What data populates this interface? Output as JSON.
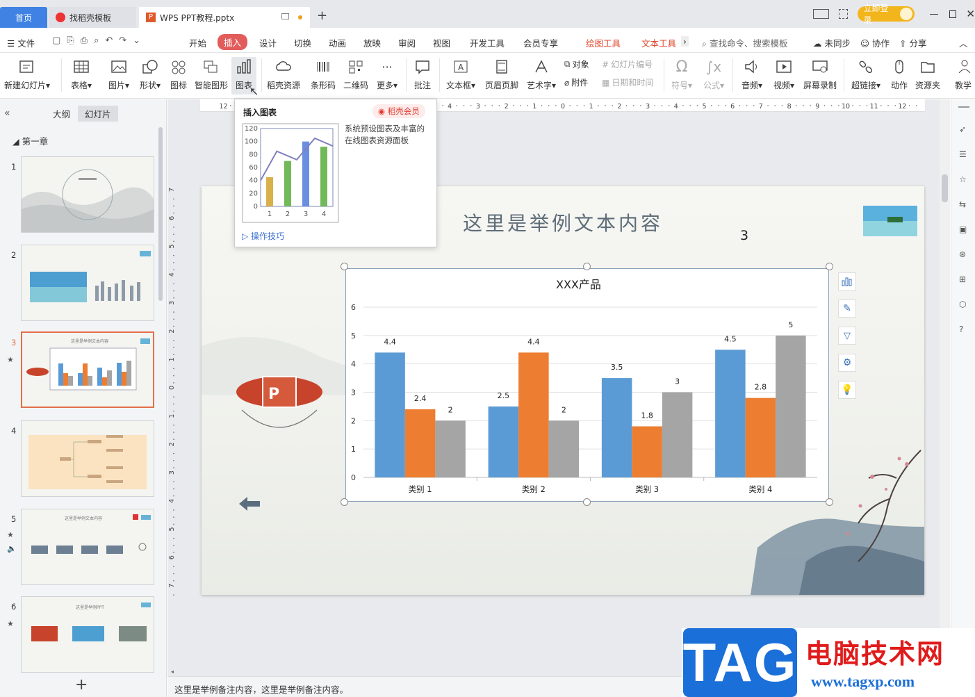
{
  "titlebar": {
    "home": "首页",
    "tab_template": "找稻壳模板",
    "tab_doc": "WPS PPT教程.pptx",
    "new_tab": "+",
    "login": "立即登录",
    "window_buttons": [
      "minimize",
      "maximize",
      "close"
    ]
  },
  "menu": {
    "file": "文件",
    "items": [
      "开始",
      "插入",
      "设计",
      "切换",
      "动画",
      "放映",
      "审阅",
      "视图",
      "开发工具",
      "会员专享"
    ],
    "active": "插入",
    "contextual": [
      "绘图工具",
      "文本工具"
    ],
    "search": "查找命令、搜索模板",
    "sync": "未同步",
    "collab": "协作",
    "share": "分享"
  },
  "ribbon": {
    "buttons": [
      "新建幻灯片",
      "表格",
      "图片",
      "形状",
      "图标",
      "智能图形",
      "图表",
      "稻壳资源",
      "条形码",
      "二维码",
      "更多",
      "批注",
      "文本框",
      "页眉页脚",
      "艺术字",
      "符号",
      "公式",
      "音频",
      "视频",
      "屏幕录制",
      "超链接",
      "动作",
      "资源夹",
      "教学"
    ],
    "small": [
      "对象",
      "附件",
      "幻灯片编号",
      "日期和时间"
    ]
  },
  "tooltip": {
    "title": "插入图表",
    "badge": "稻壳会员",
    "desc": "系统预设图表及丰富的在线图表资源面板",
    "help": "操作技巧",
    "preview": {
      "y_ticks": [
        "120",
        "100",
        "80",
        "60",
        "40",
        "20",
        "0"
      ],
      "x_ticks": [
        "1",
        "2",
        "3",
        "4"
      ]
    }
  },
  "leftpanel": {
    "tab_outline": "大纲",
    "tab_slides": "幻灯片",
    "section": "第一章",
    "add": "+",
    "slides": [
      "1",
      "2",
      "3",
      "4",
      "5",
      "6"
    ]
  },
  "slide": {
    "title": "这里是举例文本内容",
    "number": "3",
    "chart_title": "XXX产品"
  },
  "notes": "这里是举例备注内容，这里是举例备注内容。",
  "watermark": {
    "tag": "TAG",
    "site": "电脑技术网",
    "url": "www.tagxp.com"
  },
  "chart_data": [
    {
      "type": "bar",
      "title": "XXX产品",
      "categories": [
        "类别 1",
        "类别 2",
        "类别 3",
        "类别 4"
      ],
      "series": [
        {
          "values": [
            4.4,
            2.5,
            3.5,
            4.5
          ],
          "color": "#5b9bd5"
        },
        {
          "values": [
            2.4,
            4.4,
            1.8,
            2.8
          ],
          "color": "#ed7d31"
        },
        {
          "values": [
            2,
            2,
            3,
            5
          ],
          "color": "#a5a5a5"
        }
      ],
      "ylim": [
        0,
        6
      ],
      "y_ticks": [
        "0",
        "1",
        "2",
        "3",
        "4",
        "5",
        "6"
      ],
      "grid": true
    },
    {
      "type": "bar",
      "title": "",
      "categories": [
        "1",
        "2",
        "3",
        "4"
      ],
      "values": [
        45,
        70,
        100,
        92
      ],
      "colors": [
        "#d8b14b",
        "#72b95a",
        "#6a8ee0",
        "#72b95a"
      ],
      "line": [
        40,
        85,
        72,
        105
      ],
      "ylim": [
        0,
        120
      ]
    }
  ]
}
